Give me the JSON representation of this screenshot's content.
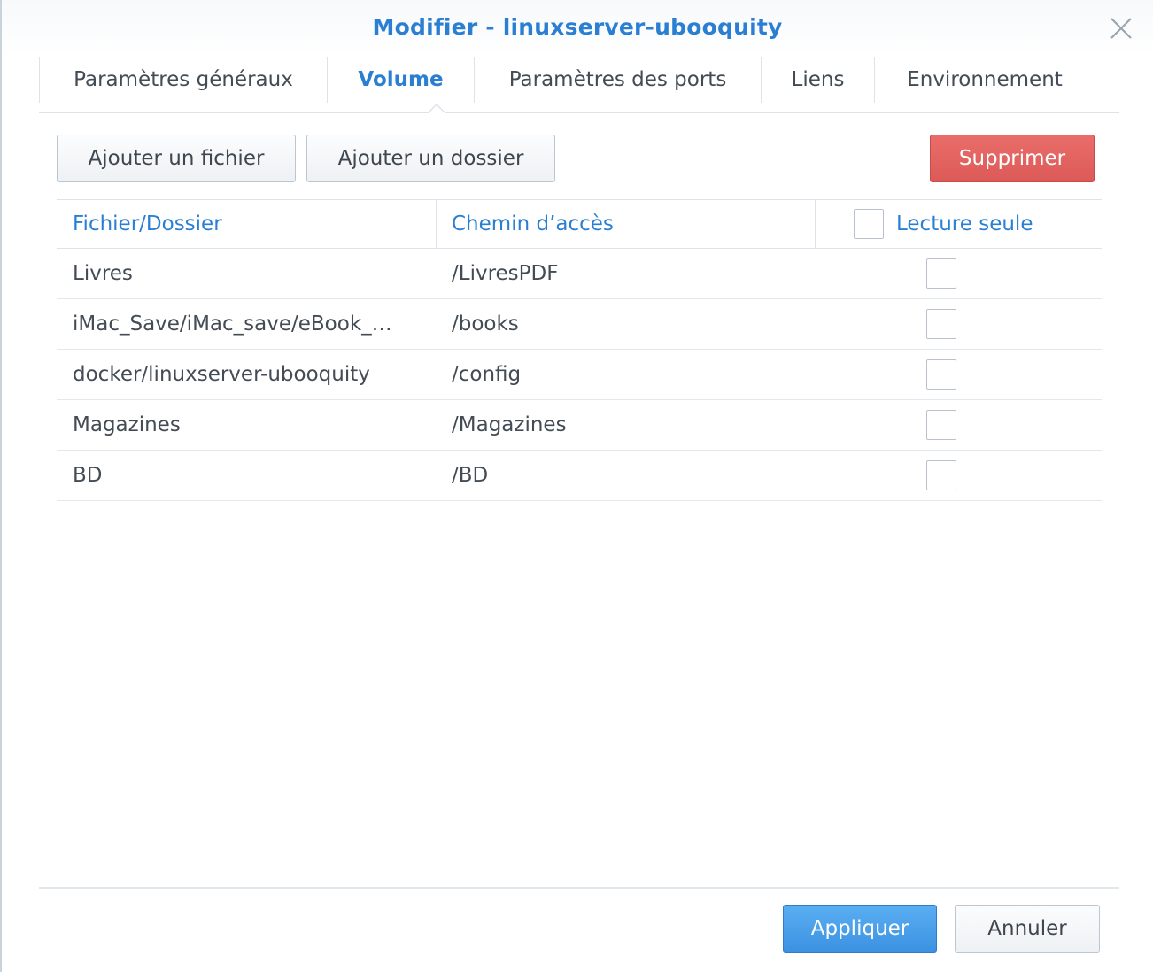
{
  "window": {
    "title": "Modifier - linuxserver-ubooquity",
    "close_icon": "close-icon"
  },
  "tabs": [
    {
      "label": "Paramètres généraux",
      "active": false
    },
    {
      "label": "Volume",
      "active": true
    },
    {
      "label": "Paramètres des ports",
      "active": false
    },
    {
      "label": "Liens",
      "active": false
    },
    {
      "label": "Environnement",
      "active": false
    }
  ],
  "toolbar": {
    "add_file_label": "Ajouter un fichier",
    "add_folder_label": "Ajouter un dossier",
    "delete_label": "Supprimer"
  },
  "table": {
    "columns": {
      "file_folder": "Fichier/Dossier",
      "mount_path": "Chemin d’accès",
      "read_only": "Lecture seule"
    },
    "header_read_only_checked": false,
    "rows": [
      {
        "file_folder": "Livres",
        "mount_path": "/LivresPDF",
        "read_only": false
      },
      {
        "file_folder": "iMac_Save/iMac_save/eBook_…",
        "mount_path": "/books",
        "read_only": false
      },
      {
        "file_folder": "docker/linuxserver-ubooquity",
        "mount_path": "/config",
        "read_only": false
      },
      {
        "file_folder": "Magazines",
        "mount_path": "/Magazines",
        "read_only": false
      },
      {
        "file_folder": "BD",
        "mount_path": "/BD",
        "read_only": false
      }
    ]
  },
  "footer": {
    "apply_label": "Appliquer",
    "cancel_label": "Annuler"
  },
  "colors": {
    "accent": "#2b7fd3",
    "danger": "#dc5a57",
    "primary": "#3c92e2"
  }
}
